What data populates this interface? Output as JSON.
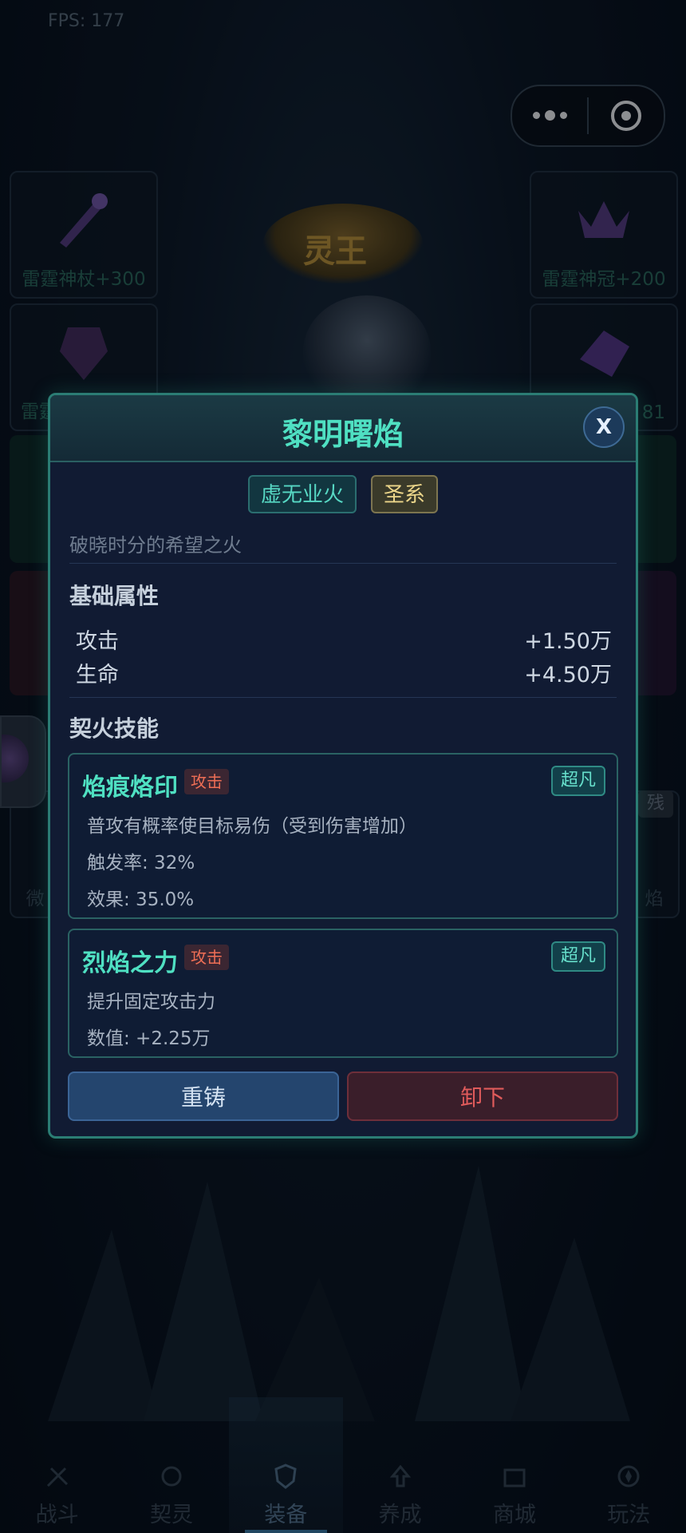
{
  "fps": "FPS: 177",
  "slots": {
    "top_left": "雷霆神杖+300",
    "top_right": "雷霆神冠+200",
    "mid_left_partial": "雷霆",
    "mid_right_partial": "81",
    "lower_left_partial": "微",
    "lower_right_partial": "焰"
  },
  "emblem_text": "灵王",
  "right_chip": "残",
  "modal": {
    "title": "黎明曙焰",
    "close_label": "X",
    "tags": [
      "虚无业火",
      "圣系"
    ],
    "flavor": "破晓时分的希望之火",
    "base_section_title": "基础属性",
    "stats": [
      {
        "name": "攻击",
        "value": "+1.50万"
      },
      {
        "name": "生命",
        "value": "+4.50万"
      }
    ],
    "skill_section_title": "契火技能",
    "skills": [
      {
        "name": "焰痕烙印",
        "type": "攻击",
        "rarity": "超凡",
        "lines": [
          "普攻有概率使目标易伤（受到伤害增加）",
          "触发率: 32%",
          "效果: 35.0%"
        ]
      },
      {
        "name": "烈焰之力",
        "type": "攻击",
        "rarity": "超凡",
        "lines": [
          "提升固定攻击力",
          "数值: +2.25万"
        ]
      }
    ],
    "reforge_label": "重铸",
    "unequip_label": "卸下"
  },
  "nav": [
    {
      "label": "战斗",
      "icon": "sword-icon"
    },
    {
      "label": "契灵",
      "icon": "spirit-icon"
    },
    {
      "label": "装备",
      "icon": "shield-icon",
      "active": true
    },
    {
      "label": "养成",
      "icon": "upgrade-icon"
    },
    {
      "label": "商城",
      "icon": "shop-icon"
    },
    {
      "label": "玩法",
      "icon": "compass-icon"
    }
  ],
  "colors": {
    "accent": "#4fe0c2",
    "modal_border": "#2b7d74",
    "danger": "#e05b5b",
    "tag_gold": "#ecd68a"
  }
}
